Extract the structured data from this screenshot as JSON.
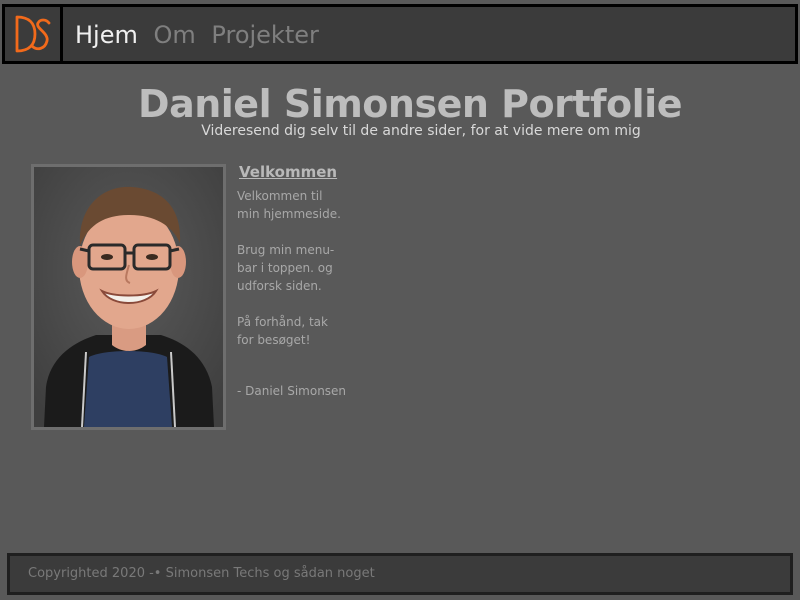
{
  "header": {
    "logo_alt": "DS",
    "nav": {
      "home": "Hjem",
      "about": "Om",
      "projects": "Projekter"
    }
  },
  "hero": {
    "title": "Daniel Simonsen Portfolie",
    "subtitle": "Videresend dig selv til de andre sider, for at vide mere om mig"
  },
  "welcome": {
    "heading": "Velkommen",
    "lines": [
      "Velkommen til",
      "min hjemmeside.",
      "Brug min menu-",
      "bar i toppen. og",
      "udforsk siden.",
      "På forhånd, tak",
      "for besøget!"
    ],
    "signature": "- Daniel Simonsen"
  },
  "footer": {
    "text": "Copyrighted 2020 -• Simonsen Techs og sådan noget"
  },
  "colors": {
    "background": "#595959",
    "bar": "#3b3b3b",
    "logo_accent": "#f26a1b",
    "title": "#bdbdbd"
  }
}
